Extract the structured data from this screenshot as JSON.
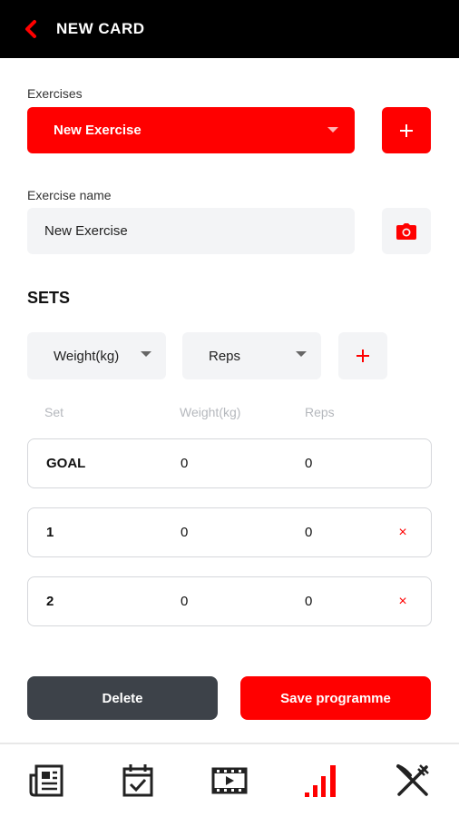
{
  "header": {
    "title": "NEW CARD",
    "back_icon": "chevron-left-icon"
  },
  "colors": {
    "accent": "#ff0000",
    "dark": "#3d4249",
    "header_bg": "#000000",
    "field_bg": "#f3f4f6"
  },
  "exercises": {
    "label": "Exercises",
    "selected": "New Exercise",
    "add_icon": "plus-icon"
  },
  "exercise_name": {
    "label": "Exercise name",
    "value": "New Exercise",
    "photo_icon": "camera-icon"
  },
  "sets": {
    "title": "SETS",
    "dropdowns": [
      "Weight(kg)",
      "Reps"
    ],
    "add_icon": "plus-icon",
    "columns": [
      "Set",
      "Weight(kg)",
      "Reps"
    ],
    "rows": [
      {
        "set": "GOAL",
        "weight": "0",
        "reps": "0"
      },
      {
        "set": "1",
        "weight": "0",
        "reps": "0",
        "remove": "×"
      },
      {
        "set": "2",
        "weight": "0",
        "reps": "0",
        "remove": "×"
      }
    ]
  },
  "actions": {
    "delete": "Delete",
    "save": "Save programme"
  },
  "tabbar": {
    "items": [
      {
        "icon": "newspaper-icon",
        "active": false
      },
      {
        "icon": "calendar-check-icon",
        "active": false
      },
      {
        "icon": "video-icon",
        "active": false
      },
      {
        "icon": "bar-chart-icon",
        "active": true
      },
      {
        "icon": "fork-knife-icon",
        "active": false
      }
    ]
  }
}
